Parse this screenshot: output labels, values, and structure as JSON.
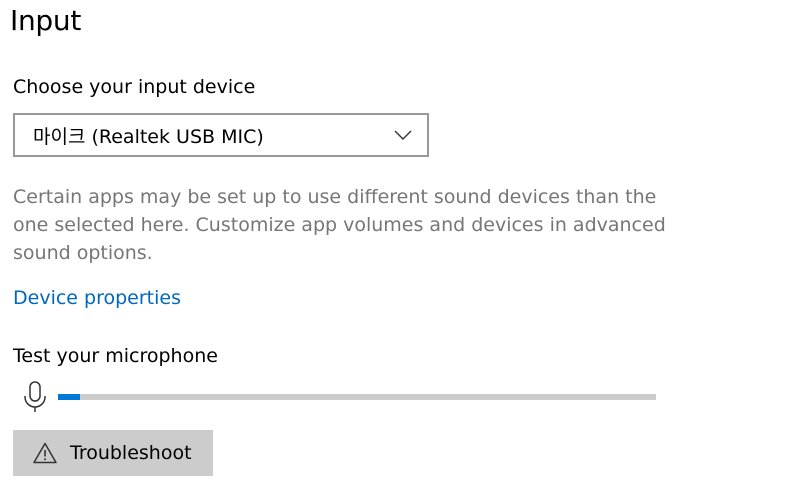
{
  "section": {
    "title": "Input"
  },
  "input_device": {
    "label": "Choose your input device",
    "selected": "마이크 (Realtek USB MIC)",
    "help_text": "Certain apps may be set up to use different sound devices than the one selected here. Customize app volumes and devices in advanced sound options.",
    "properties_link": "Device properties"
  },
  "microphone_test": {
    "label": "Test your microphone",
    "level_percent": 3.7,
    "level_color": "#0078d7",
    "track_color": "#cccccc",
    "icon": "microphone-icon"
  },
  "troubleshoot": {
    "label": "Troubleshoot",
    "icon": "warning-icon"
  },
  "colors": {
    "link": "#0067c0",
    "secondary_text": "#767676",
    "button_bg": "#cccccc",
    "select_border": "#999999"
  }
}
